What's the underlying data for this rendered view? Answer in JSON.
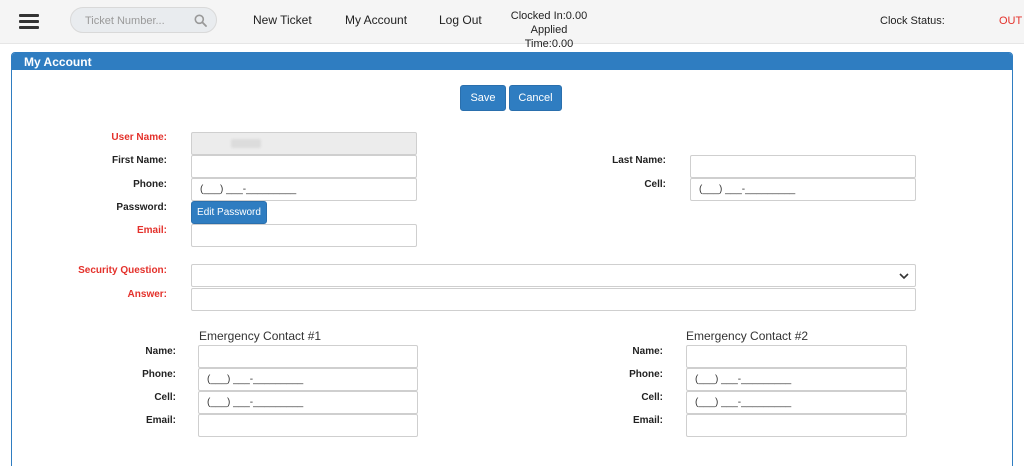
{
  "topbar": {
    "search_placeholder": "Ticket Number...",
    "nav": {
      "new_ticket": "New Ticket",
      "my_account": "My Account",
      "log_out": "Log Out"
    },
    "clocked_in": "Clocked In:0.00",
    "applied_time": "Applied Time:0.00",
    "clock_status_label": "Clock Status:",
    "clock_status_value": "OUT"
  },
  "panel": {
    "title": "My Account",
    "save_label": "Save",
    "cancel_label": "Cancel"
  },
  "form": {
    "user_name_label": "User Name:",
    "first_name_label": "First Name:",
    "last_name_label": "Last Name:",
    "phone_label": "Phone:",
    "cell_label": "Cell:",
    "password_label": "Password:",
    "edit_password_label": "Edit Password",
    "email_label": "Email:",
    "security_question_label": "Security Question:",
    "answer_label": "Answer:",
    "phone_mask": "(___) ___-_________"
  },
  "emergency": {
    "contact1_title": "Emergency Contact #1",
    "contact2_title": "Emergency Contact #2",
    "name_label": "Name:",
    "phone_label": "Phone:",
    "cell_label": "Cell:",
    "email_label": "Email:"
  },
  "colors": {
    "accent": "#2f7dc1",
    "required": "#e4312b",
    "status_out": "#e4312b"
  },
  "icons": {
    "menu": "hamburger-menu-icon",
    "search": "search-icon",
    "select": "chevron-down-icon"
  }
}
